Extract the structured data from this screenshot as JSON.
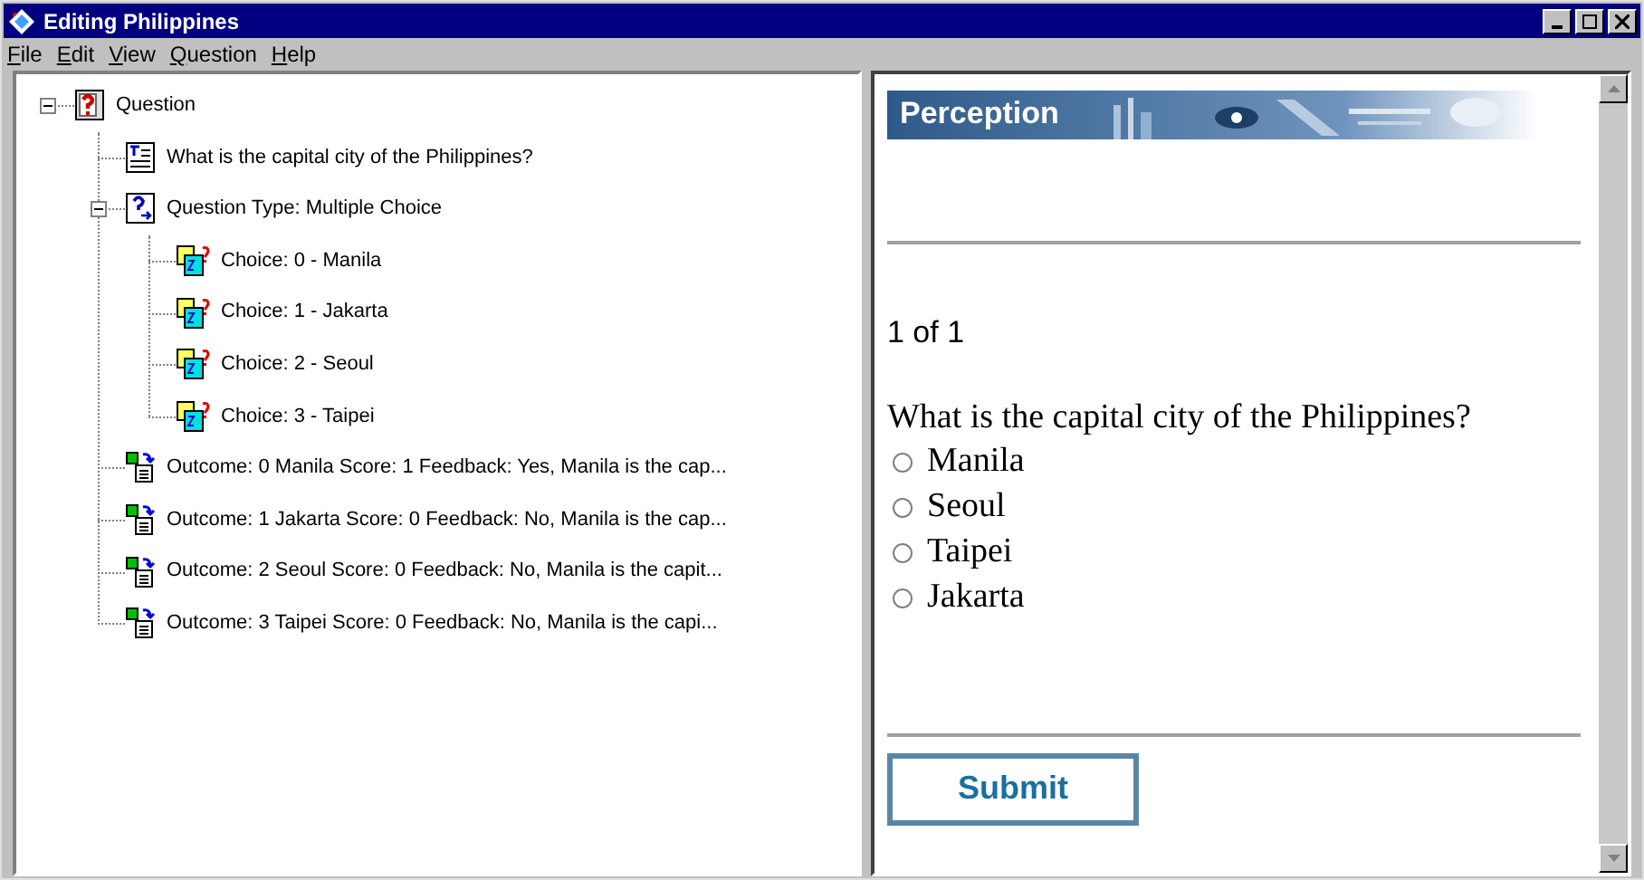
{
  "window": {
    "title": "Editing Philippines"
  },
  "menu": [
    "File",
    "Edit",
    "View",
    "Question",
    "Help"
  ],
  "tree": [
    {
      "label": "Question",
      "kind": "question",
      "expanded": true,
      "children": [
        {
          "label": "What is the capital city of the Philippines?",
          "kind": "text"
        },
        {
          "label": "Question Type: Multiple Choice",
          "kind": "type",
          "expanded": true,
          "children": [
            {
              "label": "Choice: 0 - Manila",
              "kind": "choice"
            },
            {
              "label": "Choice: 1 - Jakarta",
              "kind": "choice"
            },
            {
              "label": "Choice: 2 - Seoul",
              "kind": "choice"
            },
            {
              "label": "Choice: 3 - Taipei",
              "kind": "choice"
            }
          ]
        },
        {
          "label": "Outcome: 0 Manila Score: 1 Feedback: Yes, Manila is the cap...",
          "kind": "outcome"
        },
        {
          "label": "Outcome: 1 Jakarta Score: 0 Feedback: No, Manila is the cap...",
          "kind": "outcome"
        },
        {
          "label": "Outcome: 2 Seoul Score: 0 Feedback: No, Manila is the capit...",
          "kind": "outcome"
        },
        {
          "label": "Outcome: 3 Taipei Score: 0 Feedback: No, Manila is the capi...",
          "kind": "outcome"
        }
      ]
    }
  ],
  "preview": {
    "banner": "Perception",
    "counter": "1 of 1",
    "question": "What is the capital city of the Philippines?",
    "options": [
      {
        "label": "Manila",
        "selected": false
      },
      {
        "label": "Seoul",
        "selected": false
      },
      {
        "label": "Taipei",
        "selected": false
      },
      {
        "label": "Jakarta",
        "selected": false
      }
    ],
    "submit": "Submit"
  }
}
